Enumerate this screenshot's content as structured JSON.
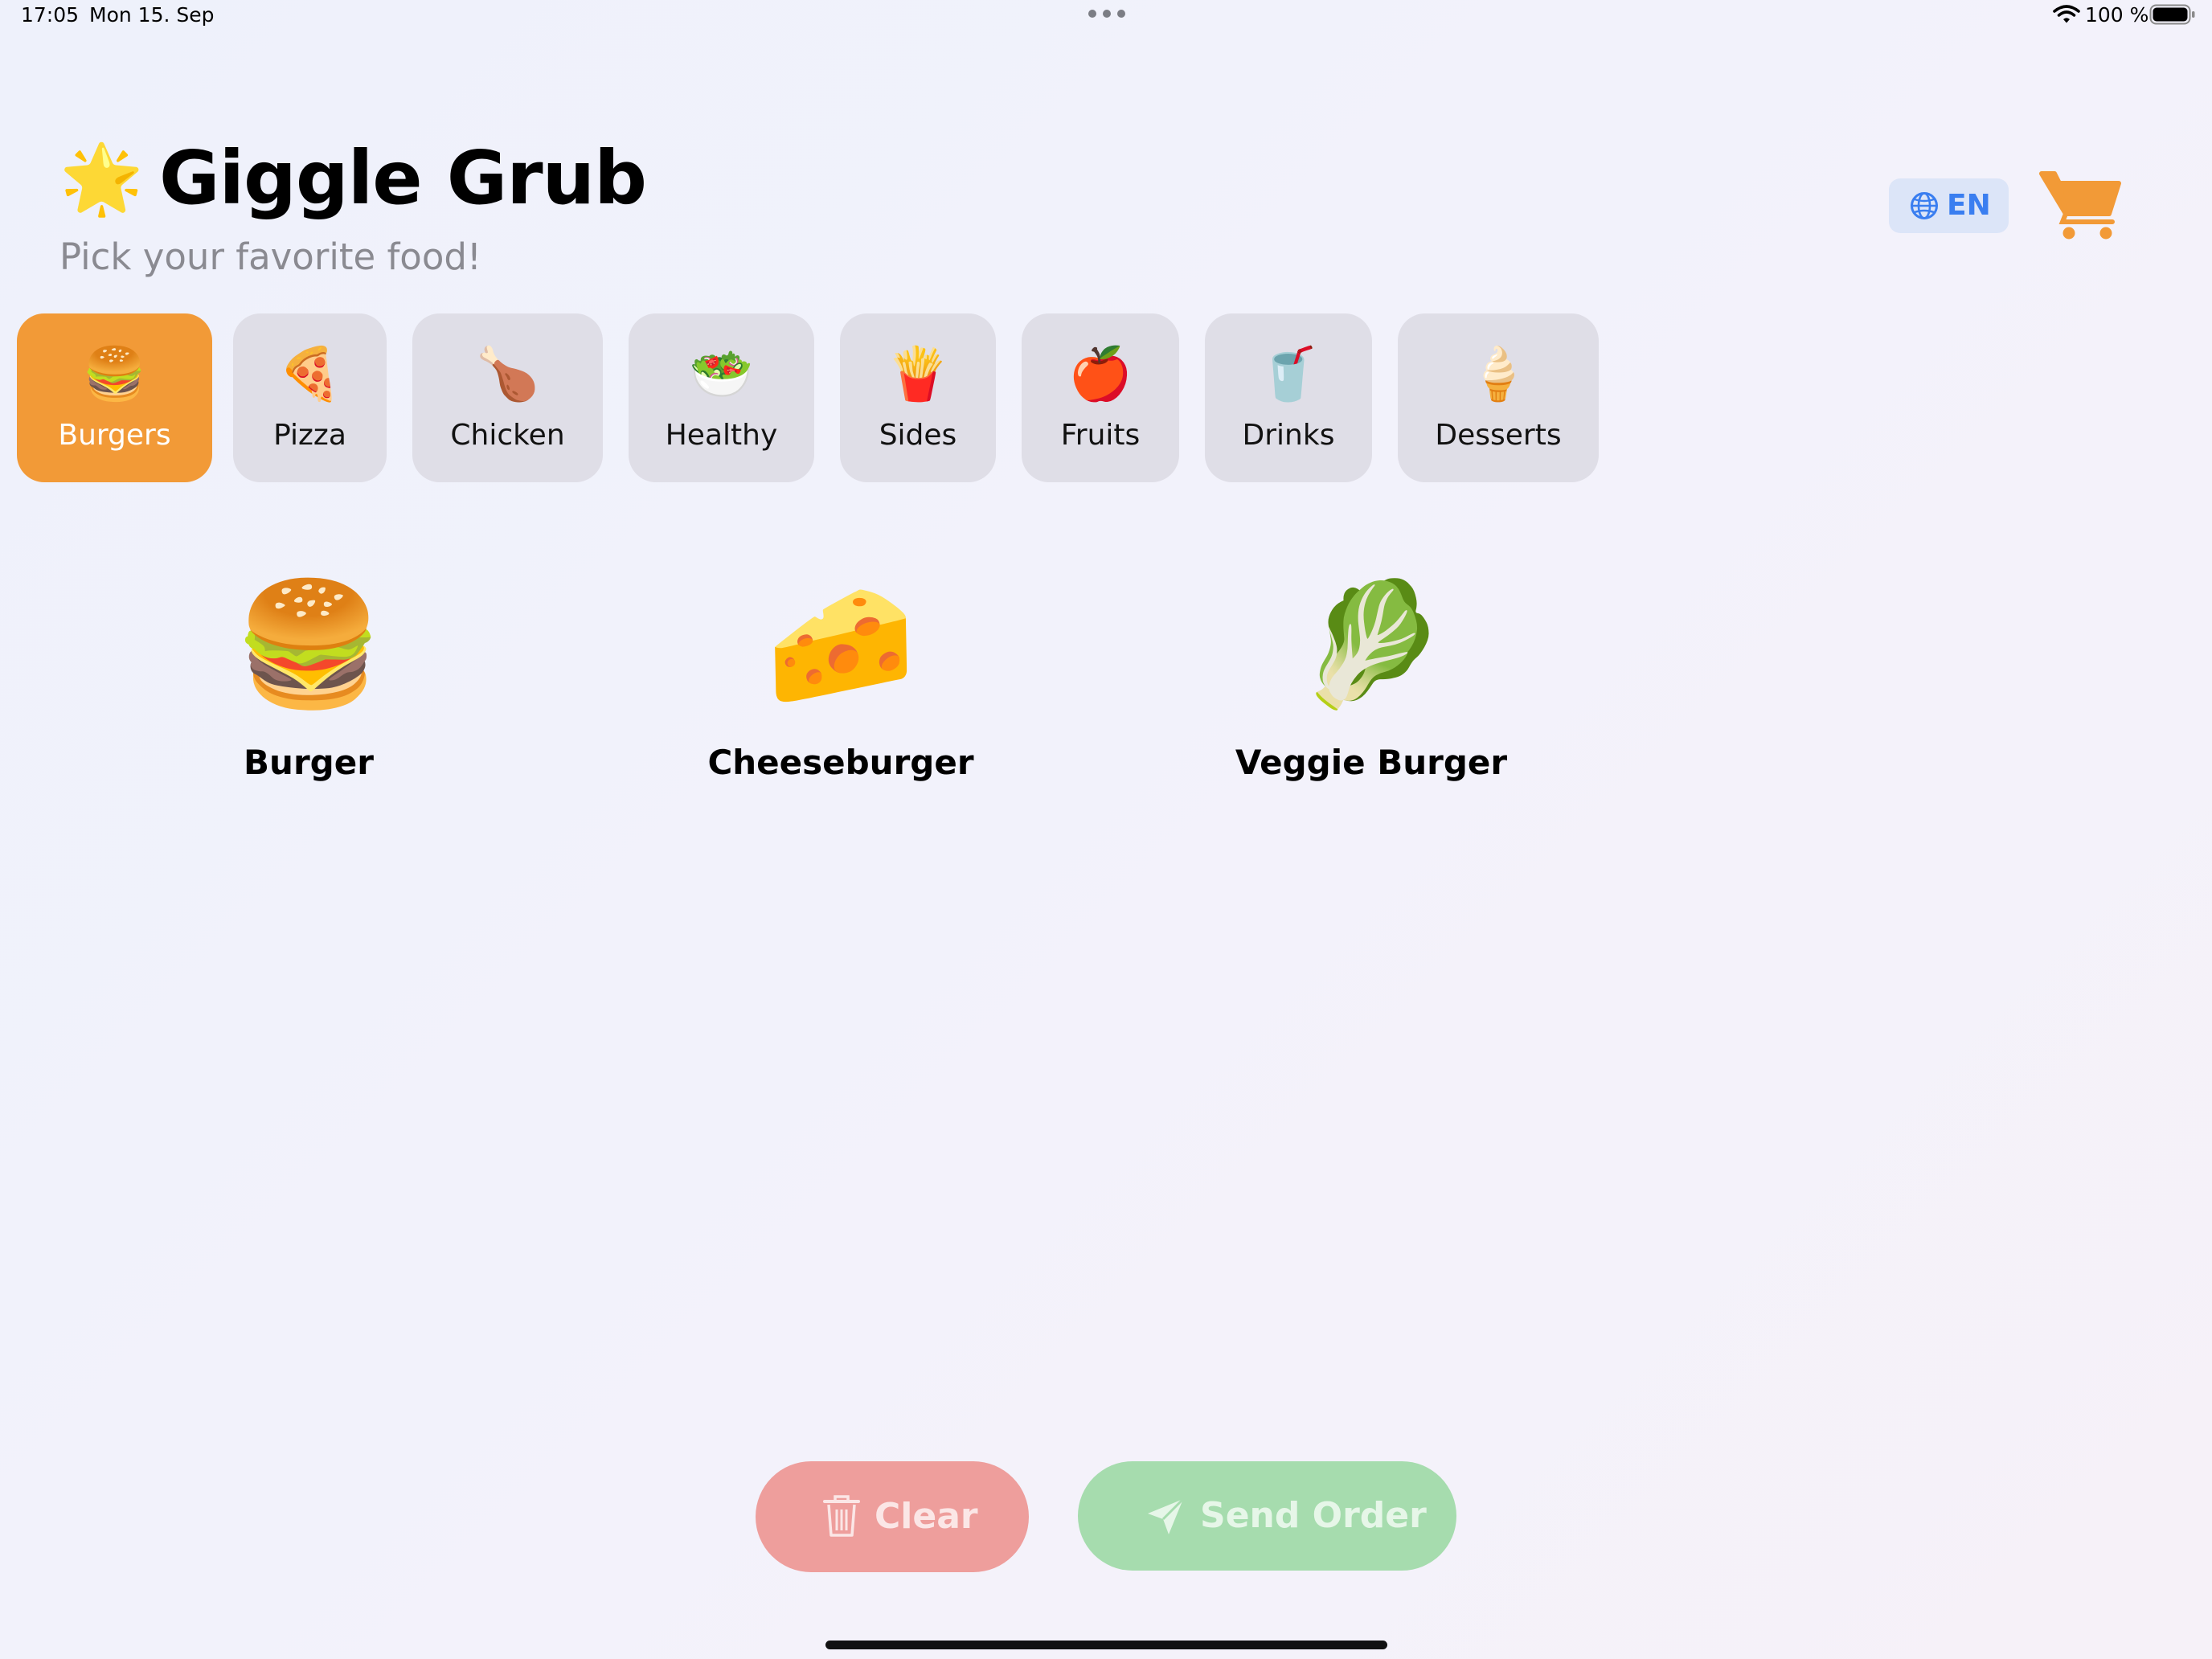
{
  "status_bar": {
    "time": "17:05",
    "date": "Mon 15. Sep",
    "battery": "100 %"
  },
  "header": {
    "star_emoji": "🌟",
    "title": "Giggle Grub",
    "subtitle": "Pick your favorite food!",
    "language": "EN",
    "cart_icon": "cart-icon",
    "accent_color": "#f29a37"
  },
  "categories": [
    {
      "emoji": "🍔",
      "label": "Burgers",
      "selected": true
    },
    {
      "emoji": "🍕",
      "label": "Pizza",
      "selected": false
    },
    {
      "emoji": "🍗",
      "label": "Chicken",
      "selected": false
    },
    {
      "emoji": "🥗",
      "label": "Healthy",
      "selected": false
    },
    {
      "emoji": "🍟",
      "label": "Sides",
      "selected": false
    },
    {
      "emoji": "🍎",
      "label": "Fruits",
      "selected": false
    },
    {
      "emoji": "🥤",
      "label": "Drinks",
      "selected": false
    },
    {
      "emoji": "🍦",
      "label": "Desserts",
      "selected": false
    }
  ],
  "menu_items": [
    {
      "emoji": "🍔",
      "label": "Burger"
    },
    {
      "emoji": "🧀",
      "label": "Cheeseburger"
    },
    {
      "emoji": "🥬",
      "label": "Veggie Burger"
    }
  ],
  "actions": {
    "clear_label": "Clear",
    "send_label": "Send Order",
    "clear_color": "#ee9e9c",
    "send_color": "#a6dcae"
  }
}
